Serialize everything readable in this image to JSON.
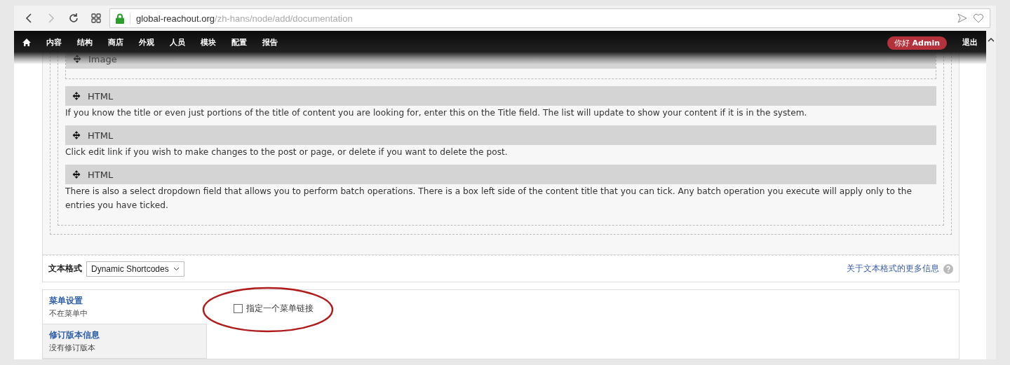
{
  "browser": {
    "url_host": "global-reachout.org",
    "url_path": "/zh-hans/node/add/documentation"
  },
  "toolbar": {
    "items": [
      "内容",
      "结构",
      "商店",
      "外观",
      "人员",
      "模块",
      "配置",
      "报告"
    ],
    "greeting": "你好",
    "user": "Admin",
    "logout": "退出"
  },
  "blocks": [
    {
      "title": "Image"
    },
    {
      "title": "HTML",
      "text": "If you know the title or even just portions of the title of content you are looking for, enter this on the Title field. The list will update to show your content if it is in the system."
    },
    {
      "title": "HTML",
      "text": "Click edit link if you wish to make changes to the post or page, or delete if you want to delete the post."
    },
    {
      "title": "HTML",
      "text": "There is also a select dropdown field that allows you to perform batch operations. There is a box left side of the content title that you can tick. Any batch operation you execute will apply only to the entries you have ticked."
    }
  ],
  "text_format": {
    "label": "文本格式",
    "value": "Dynamic Shortcodes",
    "help_link": "关于文本格式的更多信息"
  },
  "vertical_tabs": [
    {
      "title": "菜单设置",
      "summary": "不在菜单中",
      "selected": true
    },
    {
      "title": "修订版本信息",
      "summary": "没有修订版本",
      "selected": false
    }
  ],
  "menu_link": {
    "label": "指定一个菜单链接",
    "checked": false
  }
}
